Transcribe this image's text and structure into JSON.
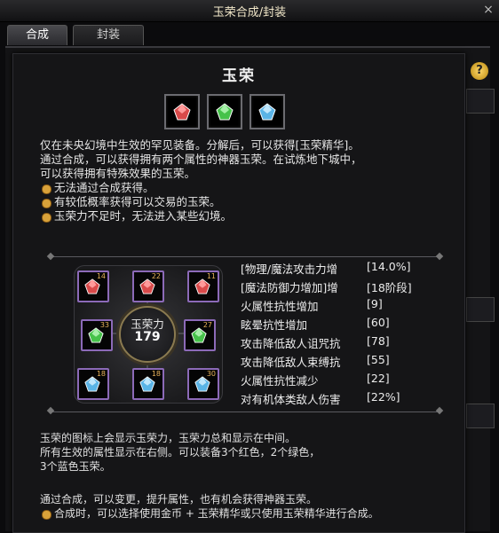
{
  "window": {
    "title": "玉荣合成/封装",
    "close": "×"
  },
  "tabs": [
    {
      "label": "合成"
    },
    {
      "label": "封装"
    }
  ],
  "help": {
    "label": "?"
  },
  "panel": {
    "title": "玉荣",
    "description": [
      "仅在未央幻境中生效的罕见装备。分解后，可以获得[玉荣精华]。",
      "通过合成，可以获得拥有两个属性的神器玉荣。在试炼地下城中，",
      "可以获得拥有特殊效果的玉荣。"
    ],
    "bullets": [
      "无法通过合成获得。",
      "有较低概率获得可以交易的玉荣。",
      "玉荣力不足时，无法进入某些幻境。"
    ]
  },
  "center": {
    "label": "玉荣力",
    "value": "179"
  },
  "slots": [
    {
      "num": "14",
      "color": "red"
    },
    {
      "num": "22",
      "color": "red"
    },
    {
      "num": "11",
      "color": "red"
    },
    {
      "num": "33",
      "color": "green"
    },
    {
      "num": "27",
      "color": "green"
    },
    {
      "num": "18",
      "color": "blue"
    },
    {
      "num": "18",
      "color": "blue"
    },
    {
      "num": "30",
      "color": "blue"
    }
  ],
  "attributes": [
    {
      "name": "[物理/魔法攻击力增",
      "value": "[14.0%]"
    },
    {
      "name": "[魔法防御力增加]增",
      "value": "[18阶段]"
    },
    {
      "name": "火属性抗性增加",
      "value": "[9]"
    },
    {
      "name": "眩晕抗性增加",
      "value": "[60]"
    },
    {
      "name": "攻击降低敌人诅咒抗",
      "value": "[78]"
    },
    {
      "name": "攻击降低敌人束缚抗",
      "value": "[55]"
    },
    {
      "name": "火属性抗性减少",
      "value": "[22]"
    },
    {
      "name": "对有机体类敌人伤害",
      "value": "[22%]"
    }
  ],
  "info": [
    "玉荣的图标上会显示玉荣力，玉荣力总和显示在中间。",
    "所有生效的属性显示在右侧。可以装备3个红色，2个绿色，",
    "3个蓝色玉荣。"
  ],
  "footer": {
    "line1": "通过合成，可以变更，提升属性，也有机会获得神器玉荣。",
    "line2": "合成时，可以选择使用金币 + 玉荣精华或只使用玉荣精华进行合成。"
  },
  "colors": {
    "red": "#d94a4a",
    "green": "#46c24a",
    "blue": "#5ab4e6",
    "accent": "#d9a23a"
  }
}
